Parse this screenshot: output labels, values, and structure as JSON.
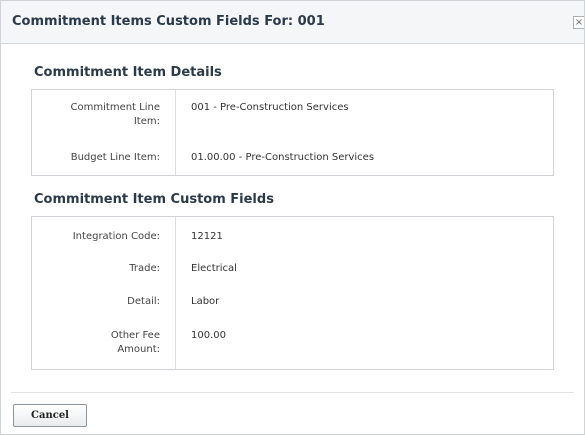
{
  "dialog": {
    "title": "Commitment Items Custom Fields For:   001",
    "close_glyph": "×"
  },
  "details": {
    "heading": "Commitment Item Details",
    "rows": [
      {
        "label_line1": "Commitment Line",
        "label_line2": "Item:",
        "value": "001 - Pre-Construction Services"
      },
      {
        "label": "Budget Line Item:",
        "value": "01.00.00 - Pre-Construction Services"
      }
    ]
  },
  "custom": {
    "heading": "Commitment Item Custom Fields",
    "rows": [
      {
        "label": "Integration Code:",
        "value": "12121"
      },
      {
        "label": "Trade:",
        "value": "Electrical"
      },
      {
        "label": "Detail:",
        "value": "Labor"
      },
      {
        "label_line1": "Other Fee",
        "label_line2": "Amount:",
        "value": "100.00"
      }
    ]
  },
  "footer": {
    "cancel_label": "Cancel"
  }
}
